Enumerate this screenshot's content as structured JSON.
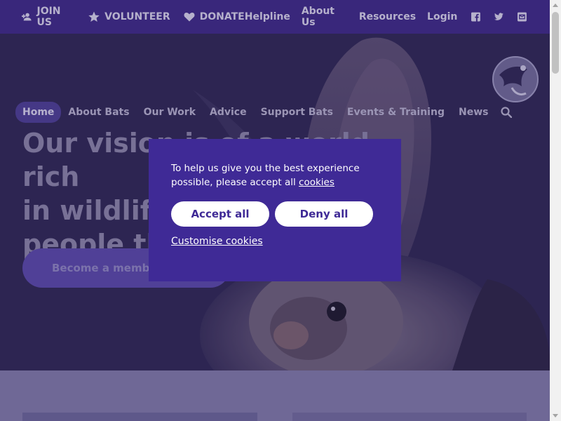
{
  "topbar": {
    "join": "JOIN US",
    "volunteer": "VOLUNTEER",
    "donate": "DONATE",
    "links": [
      "Helpline",
      "About Us",
      "Resources",
      "Login"
    ],
    "social_icons": [
      "facebook-icon",
      "twitter-icon",
      "email-icon"
    ]
  },
  "nav": {
    "items": [
      "Home",
      "About Bats",
      "Our Work",
      "Advice",
      "Support Bats",
      "Events & Training",
      "News"
    ],
    "active": "Home"
  },
  "hero": {
    "heading_line1": "Our vision is of a world rich",
    "heading_line2": "in wildlife",
    "heading_line3": "people thr",
    "button": "Become a member"
  },
  "cookie_modal": {
    "text": "To help us give you the best experience possible, please accept all",
    "link": "cookies",
    "accept": "Accept all",
    "deny": "Deny all",
    "customise": "Customise cookies"
  },
  "colors": {
    "brand": "#3f2a96",
    "topbar": "#3d2a86",
    "hero_bg": "#2f2853"
  }
}
